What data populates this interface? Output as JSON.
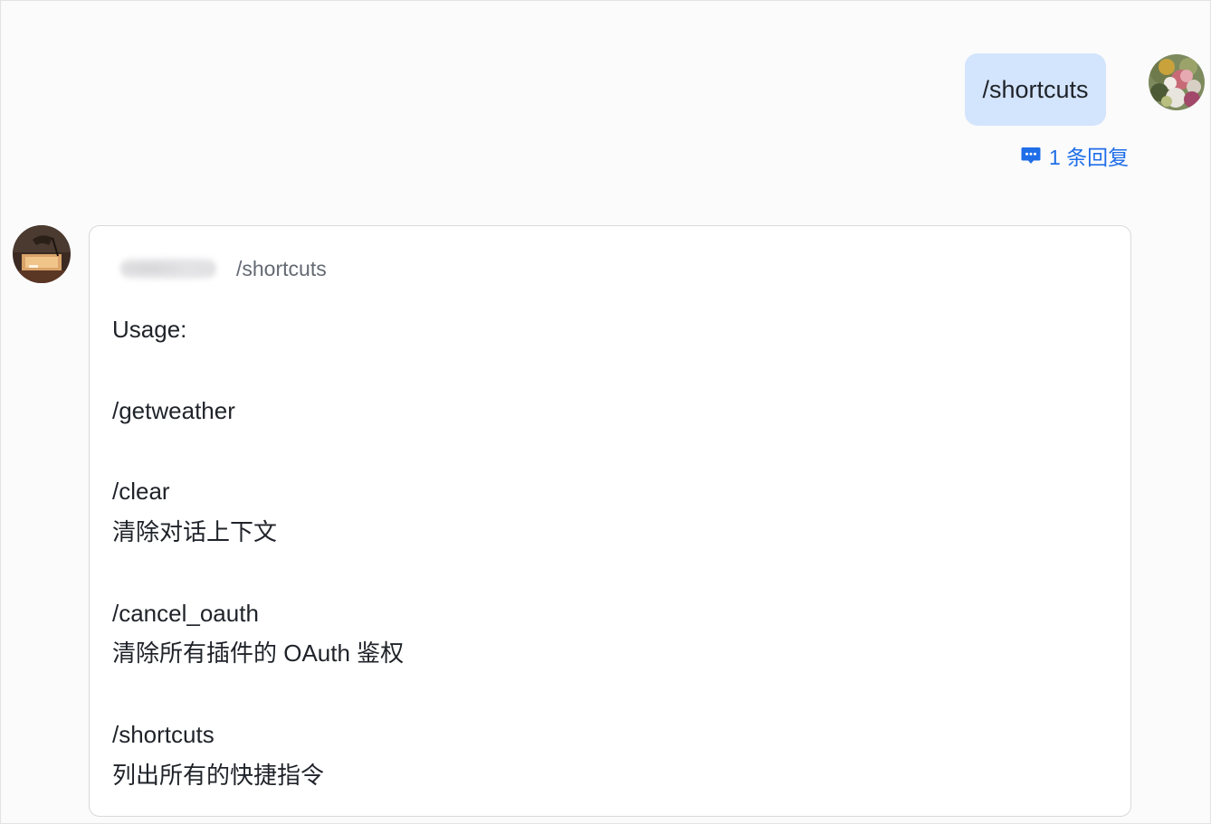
{
  "user_message": {
    "text": "/shortcuts",
    "avatar_icon": "user-avatar-flowers"
  },
  "reply_link": {
    "icon": "comment-icon",
    "label": "1 条回复",
    "color": "#1f6ee8"
  },
  "bot_message": {
    "avatar_icon": "bot-avatar-lamp-desk",
    "quote": {
      "command": "/shortcuts"
    },
    "usage_title": "Usage:",
    "commands": [
      {
        "name": "/getweather",
        "description": ""
      },
      {
        "name": "/clear",
        "description": "清除对话上下文"
      },
      {
        "name": "/cancel_oauth",
        "description": "清除所有插件的 OAuth 鉴权"
      },
      {
        "name": "/shortcuts",
        "description": "列出所有的快捷指令"
      }
    ]
  },
  "colors": {
    "user_bubble": "#d3e4fd",
    "card_border": "#d9d9db",
    "background": "#fbfbfc"
  }
}
